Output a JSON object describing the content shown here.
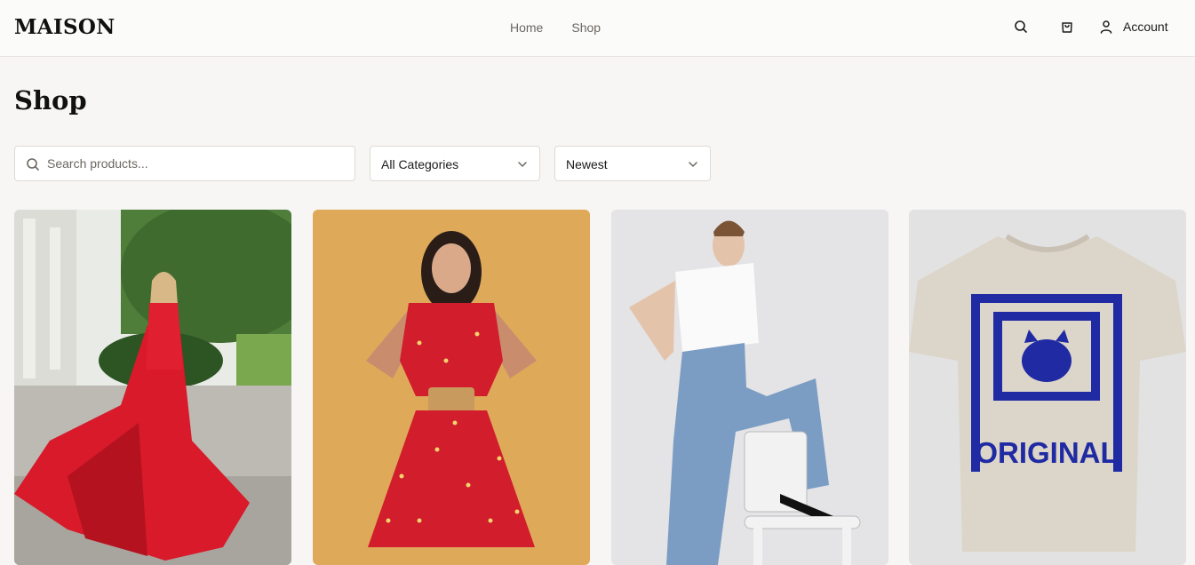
{
  "brand": "MAISON",
  "nav": {
    "items": [
      "Home",
      "Shop"
    ]
  },
  "header": {
    "account_label": "Account",
    "icons": [
      "search-icon",
      "cart-icon",
      "user-icon"
    ]
  },
  "page": {
    "title": "Shop"
  },
  "filters": {
    "search_placeholder": "Search products...",
    "category_selected": "All Categories",
    "sort_selected": "Newest"
  },
  "products": [
    {
      "image": "red-gown-photo"
    },
    {
      "image": "red-floral-dress-photo"
    },
    {
      "image": "white-tee-jeans-photo"
    },
    {
      "image": "graphic-tshirt-photo",
      "print_text": "ORIGINAL"
    }
  ],
  "colors": {
    "background": "#f7f6f4",
    "header": "#fbfbfa",
    "border": "#dedad5",
    "muted_text": "#6b6660"
  }
}
